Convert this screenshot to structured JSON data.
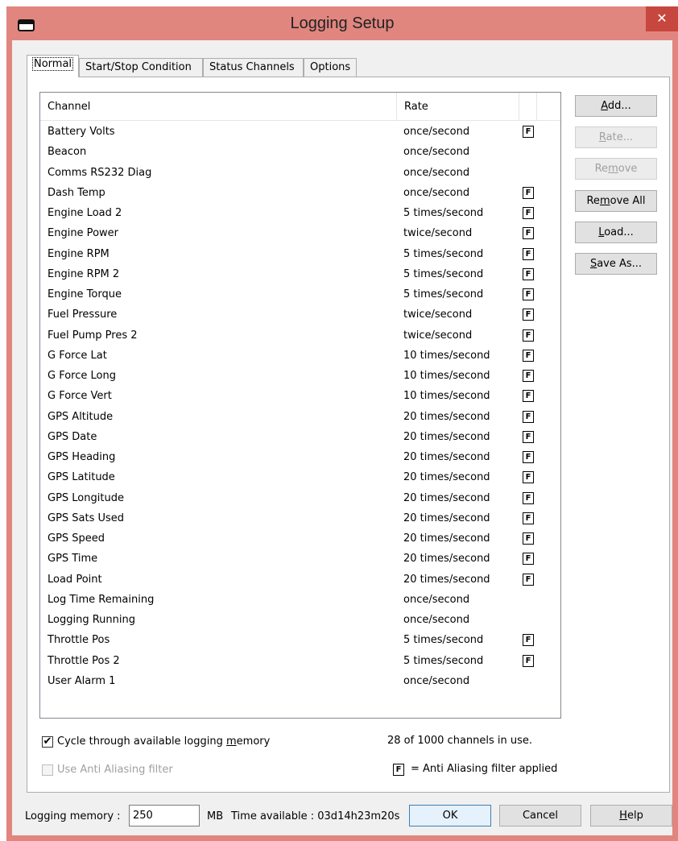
{
  "window": {
    "title": "Logging Setup",
    "close_glyph": "✕",
    "accent_color": "#e0867f"
  },
  "tabs": [
    {
      "label": "Normal",
      "active": true
    },
    {
      "label": "Start/Stop Condition",
      "active": false
    },
    {
      "label": "Status Channels",
      "active": false
    },
    {
      "label": "Options",
      "active": false
    }
  ],
  "list": {
    "columns": {
      "channel": "Channel",
      "rate": "Rate"
    },
    "rows": [
      {
        "channel": "Battery Volts",
        "rate": "once/second",
        "flag": "F"
      },
      {
        "channel": "Beacon",
        "rate": "once/second",
        "flag": ""
      },
      {
        "channel": "Comms RS232 Diag",
        "rate": "once/second",
        "flag": ""
      },
      {
        "channel": "Dash Temp",
        "rate": "once/second",
        "flag": "F"
      },
      {
        "channel": "Engine Load 2",
        "rate": "5 times/second",
        "flag": "F"
      },
      {
        "channel": "Engine Power",
        "rate": "twice/second",
        "flag": "F"
      },
      {
        "channel": "Engine RPM",
        "rate": "5 times/second",
        "flag": "F"
      },
      {
        "channel": "Engine RPM 2",
        "rate": "5 times/second",
        "flag": "F"
      },
      {
        "channel": "Engine Torque",
        "rate": "5 times/second",
        "flag": "F"
      },
      {
        "channel": "Fuel Pressure",
        "rate": "twice/second",
        "flag": "F"
      },
      {
        "channel": "Fuel Pump Pres 2",
        "rate": "twice/second",
        "flag": "F"
      },
      {
        "channel": "G Force Lat",
        "rate": "10 times/second",
        "flag": "F"
      },
      {
        "channel": "G Force Long",
        "rate": "10 times/second",
        "flag": "F"
      },
      {
        "channel": "G Force Vert",
        "rate": "10 times/second",
        "flag": "F"
      },
      {
        "channel": "GPS Altitude",
        "rate": "20 times/second",
        "flag": "F"
      },
      {
        "channel": "GPS Date",
        "rate": "20 times/second",
        "flag": "F"
      },
      {
        "channel": "GPS Heading",
        "rate": "20 times/second",
        "flag": "F"
      },
      {
        "channel": "GPS Latitude",
        "rate": "20 times/second",
        "flag": "F"
      },
      {
        "channel": "GPS Longitude",
        "rate": "20 times/second",
        "flag": "F"
      },
      {
        "channel": "GPS Sats Used",
        "rate": "20 times/second",
        "flag": "F"
      },
      {
        "channel": "GPS Speed",
        "rate": "20 times/second",
        "flag": "F"
      },
      {
        "channel": "GPS Time",
        "rate": "20 times/second",
        "flag": "F"
      },
      {
        "channel": "Load Point",
        "rate": "20 times/second",
        "flag": "F"
      },
      {
        "channel": "Log Time Remaining",
        "rate": "once/second",
        "flag": ""
      },
      {
        "channel": "Logging Running",
        "rate": "once/second",
        "flag": ""
      },
      {
        "channel": "Throttle Pos",
        "rate": "5 times/second",
        "flag": "F"
      },
      {
        "channel": "Throttle Pos 2",
        "rate": "5 times/second",
        "flag": "F"
      },
      {
        "channel": "User Alarm 1",
        "rate": "once/second",
        "flag": ""
      }
    ]
  },
  "buttons": {
    "add": "Add...",
    "rate": "Rate...",
    "remove": "Remove",
    "remove_all": "Remove All",
    "load": "Load...",
    "save_as": "Save As..."
  },
  "options": {
    "cycle_label": "Cycle through available logging memory",
    "cycle_checked": true,
    "anti_alias_label": "Use Anti Aliasing filter",
    "anti_alias_checked": false,
    "channels_in_use": "28 of 1000 channels in use.",
    "legend_flag": "F",
    "legend_text": "= Anti Aliasing filter applied"
  },
  "footer": {
    "memory_label": "Logging memory :",
    "memory_value": "250",
    "memory_unit": "MB",
    "time_available": "Time available : 03d14h23m20s",
    "ok": "OK",
    "cancel": "Cancel",
    "help": "Help"
  }
}
